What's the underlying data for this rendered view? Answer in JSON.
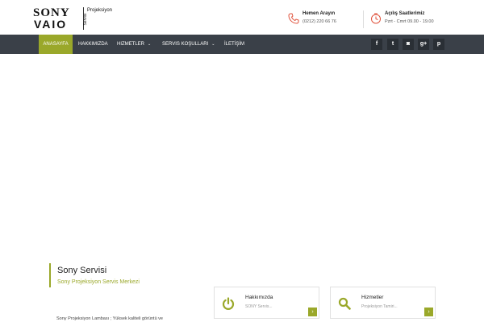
{
  "logo": {
    "brand_top": "SONY",
    "brand_bottom": "VAIO",
    "side_text": "Servisi",
    "right_text": "Projeksiyon"
  },
  "contacts": [
    {
      "title": "Hemen Arayın",
      "detail": "(0212) 220 66 76",
      "icon": "phone-icon"
    },
    {
      "title": "Açılış Saatlerimiz",
      "detail": "Pzrt - Cmrt 09.00 - 19.00",
      "icon": "clock-icon"
    }
  ],
  "nav": {
    "items": [
      {
        "label": "ANASAYFA",
        "active": true
      },
      {
        "label": "HAKKIMIZDA"
      },
      {
        "label": "HIZMETLER",
        "has_caret": true
      },
      {
        "label": "SERVIS KOŞULLARI",
        "has_caret": true
      },
      {
        "label": "İLETİŞİM"
      }
    ],
    "caret": "⌄",
    "social": [
      {
        "name": "facebook-icon",
        "glyph": "f"
      },
      {
        "name": "twitter-icon",
        "glyph": "t"
      },
      {
        "name": "instagram-icon",
        "glyph": "◙"
      },
      {
        "name": "google-plus-icon",
        "glyph": "g+"
      },
      {
        "name": "pinterest-icon",
        "glyph": "p"
      }
    ]
  },
  "about": {
    "title": "Sony Servisi",
    "subtitle": "Sony Projeksiyon Servis Merkezi",
    "description": "Sony Projeksiyon Lambası ; Yüksek kaliteli görüntü ve"
  },
  "cards": [
    {
      "title": "Hakkımızda",
      "text": "SONY Servis...",
      "icon": "power-icon",
      "arrow": "›"
    },
    {
      "title": "Hizmetler",
      "text": "Projeksiyon Tamiri...",
      "icon": "search-icon",
      "arrow": "›"
    }
  ],
  "colors": {
    "accent": "#9aa82a",
    "nav_bg": "#3a4048",
    "icon_red": "#e0533d"
  }
}
